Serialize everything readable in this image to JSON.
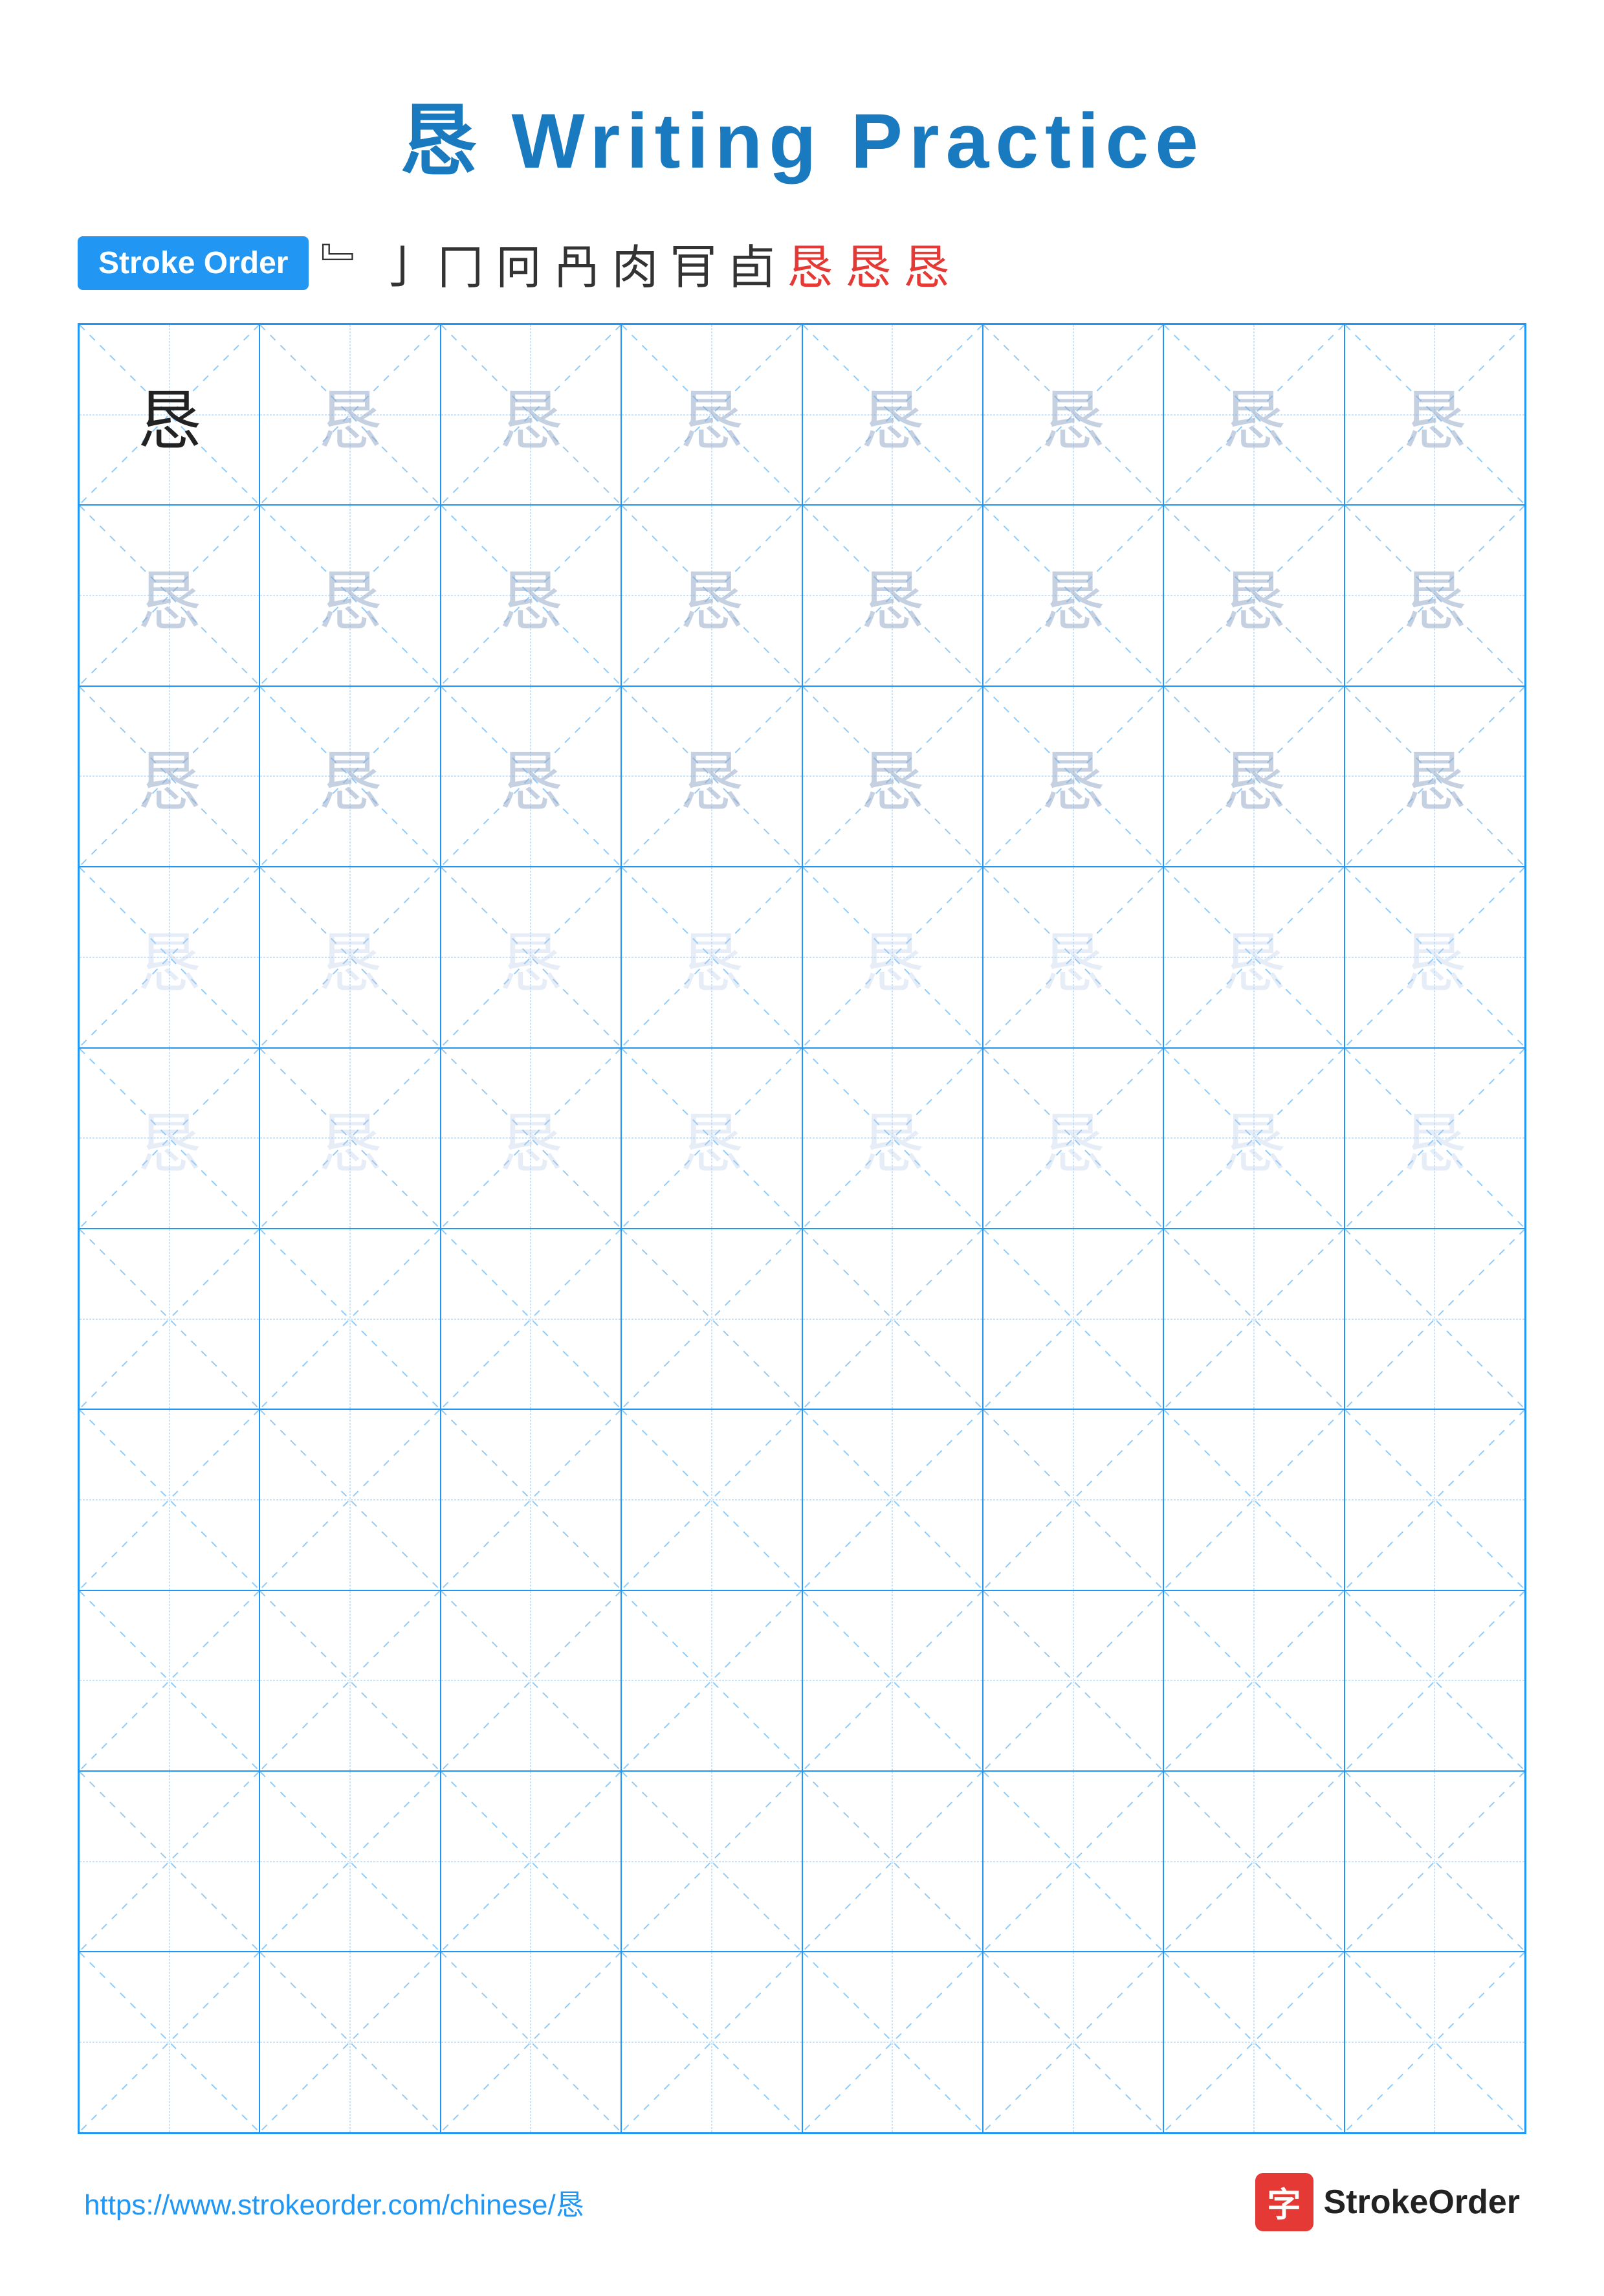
{
  "title": {
    "char": "恳",
    "label": "Writing Practice"
  },
  "stroke_order": {
    "badge_label": "Stroke Order",
    "strokes": [
      "﹄",
      "亅",
      "冂",
      "冋",
      "冎",
      "肉",
      "肎",
      "卣",
      "恳",
      "恳",
      "恳"
    ]
  },
  "grid": {
    "rows": 10,
    "cols": 8,
    "char": "恳",
    "filled_rows": 5,
    "opacity_levels": [
      "dark",
      "med",
      "med",
      "light",
      "light"
    ]
  },
  "footer": {
    "url": "https://www.strokeorder.com/chinese/恳",
    "logo_char": "字",
    "logo_name": "StrokeOrder"
  }
}
